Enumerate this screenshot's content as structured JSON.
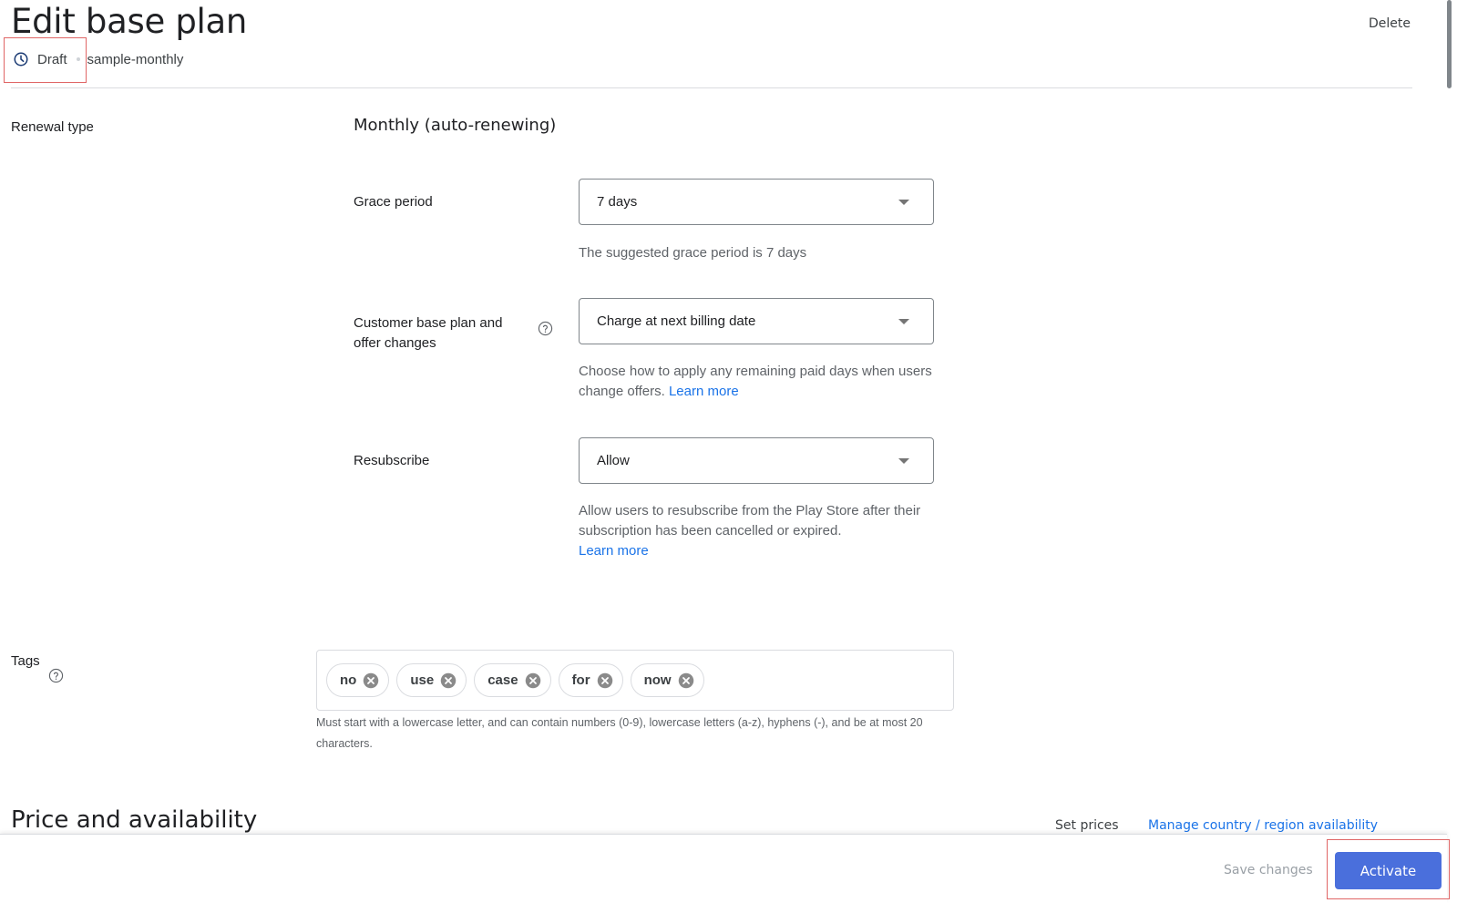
{
  "header": {
    "title": "Edit base plan",
    "status": "Draft",
    "status_icon": "clock-icon",
    "plan_id": "sample-monthly",
    "delete_label": "Delete"
  },
  "renewal": {
    "label": "Renewal type",
    "value": "Monthly (auto-renewing)"
  },
  "grace_period": {
    "label": "Grace period",
    "value": "7 days",
    "hint": "The suggested grace period is 7 days"
  },
  "plan_changes": {
    "label": "Customer base plan and offer changes",
    "value": "Charge at next billing date",
    "hint": "Choose how to apply any remaining paid days when users change offers.",
    "link": "Learn more"
  },
  "resubscribe": {
    "label": "Resubscribe",
    "value": "Allow",
    "hint": "Allow users to resubscribe from the Play Store after their subscription has been cancelled or expired.",
    "link": "Learn more"
  },
  "tags": {
    "label": "Tags",
    "items": [
      "no",
      "use",
      "case",
      "for",
      "now"
    ],
    "hint": "Must start with a lowercase letter, and can contain numbers (0-9), lowercase letters (a-z), hyphens (-), and be at most 20 characters."
  },
  "price": {
    "title": "Price and availability",
    "set_prices": "Set prices",
    "manage_link": "Manage country / region availability"
  },
  "footer": {
    "save_label": "Save changes",
    "activate_label": "Activate"
  },
  "colors": {
    "accent": "#4a6fdc",
    "link": "#1a73e8",
    "highlight": "#e06666"
  }
}
